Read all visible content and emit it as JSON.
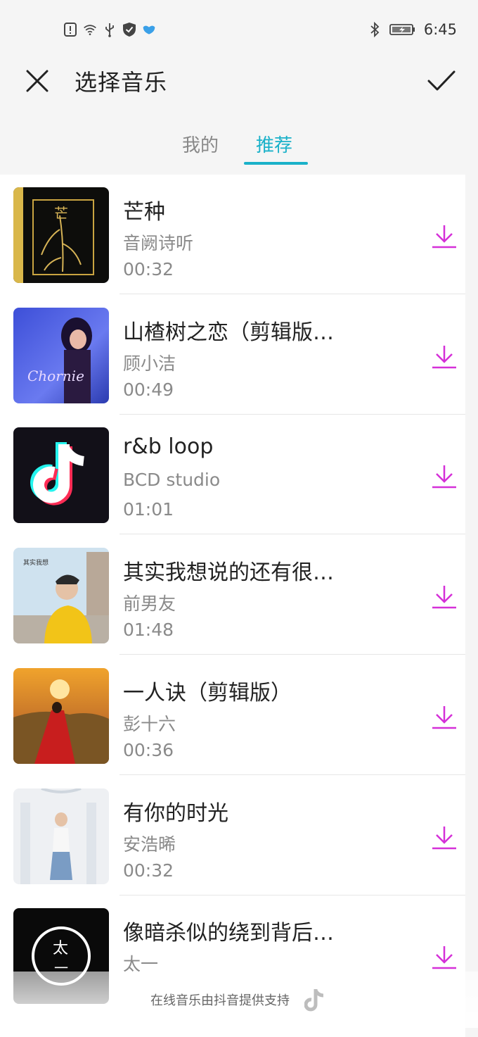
{
  "status_bar": {
    "time": "6:45",
    "icons": [
      "alert-icon",
      "wifi-icon",
      "usb-icon",
      "shield-icon",
      "app-notification-icon"
    ],
    "right_icons": [
      "bluetooth-icon",
      "battery-icon"
    ]
  },
  "header": {
    "title": "选择音乐",
    "close_icon": "close-icon",
    "confirm_icon": "check-icon"
  },
  "tabs": {
    "mine": "我的",
    "recommended": "推荐",
    "active": "推荐",
    "accent_color": "#1ab1c9"
  },
  "songs": [
    {
      "title": "芒种",
      "artist": "音阙诗听",
      "duration": "00:32"
    },
    {
      "title": "山楂树之恋（剪辑版…",
      "artist": "顾小洁",
      "duration": "00:49"
    },
    {
      "title": "r&b loop",
      "artist": "BCD studio",
      "duration": "01:01"
    },
    {
      "title": "其实我想说的还有很…",
      "artist": "前男友",
      "duration": "01:48"
    },
    {
      "title": "一人诀（剪辑版）",
      "artist": "彭十六",
      "duration": "00:36"
    },
    {
      "title": "有你的时光",
      "artist": "安浩晞",
      "duration": "00:32"
    },
    {
      "title": "像暗杀似的绕到背后…",
      "artist": "太一",
      "duration": ""
    }
  ],
  "download_color": "#d530d8",
  "footer": {
    "text": "在线音乐由抖音提供支持",
    "icon": "tiktok-logo-icon"
  }
}
